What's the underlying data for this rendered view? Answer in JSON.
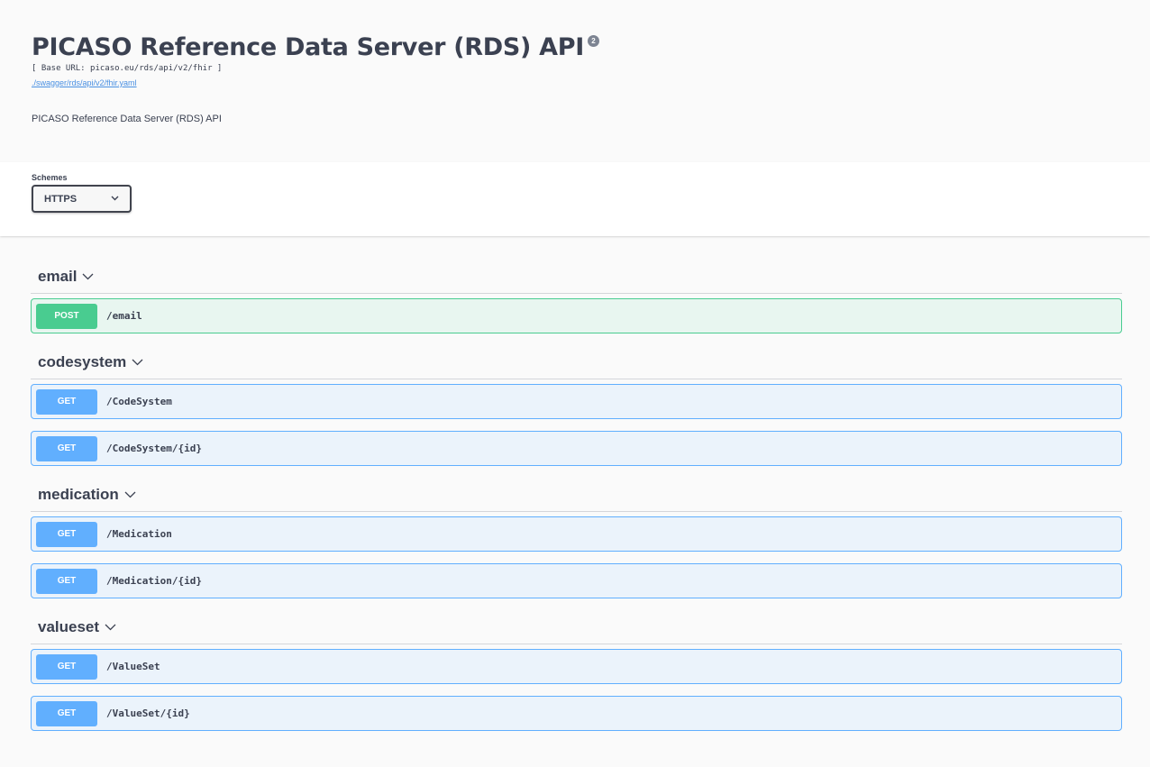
{
  "info": {
    "title": "PICASO Reference Data Server (RDS) API",
    "version_badge": "2",
    "base_url": "[ Base URL: picaso.eu/rds/api/v2/fhir ]",
    "spec_link": "./swagger/rds/api/v2/fhir.yaml",
    "description": "PICASO Reference Data Server (RDS) API"
  },
  "schemes": {
    "label": "Schemes",
    "selected": "HTTPS"
  },
  "tags": [
    {
      "name": "email",
      "operations": [
        {
          "method": "POST",
          "path": "/email"
        }
      ]
    },
    {
      "name": "codesystem",
      "operations": [
        {
          "method": "GET",
          "path": "/CodeSystem"
        },
        {
          "method": "GET",
          "path": "/CodeSystem/{id}"
        }
      ]
    },
    {
      "name": "medication",
      "operations": [
        {
          "method": "GET",
          "path": "/Medication"
        },
        {
          "method": "GET",
          "path": "/Medication/{id}"
        }
      ]
    },
    {
      "name": "valueset",
      "operations": [
        {
          "method": "GET",
          "path": "/ValueSet"
        },
        {
          "method": "GET",
          "path": "/ValueSet/{id}"
        }
      ]
    }
  ],
  "colors": {
    "post": "#49cc90",
    "get": "#61affe"
  }
}
